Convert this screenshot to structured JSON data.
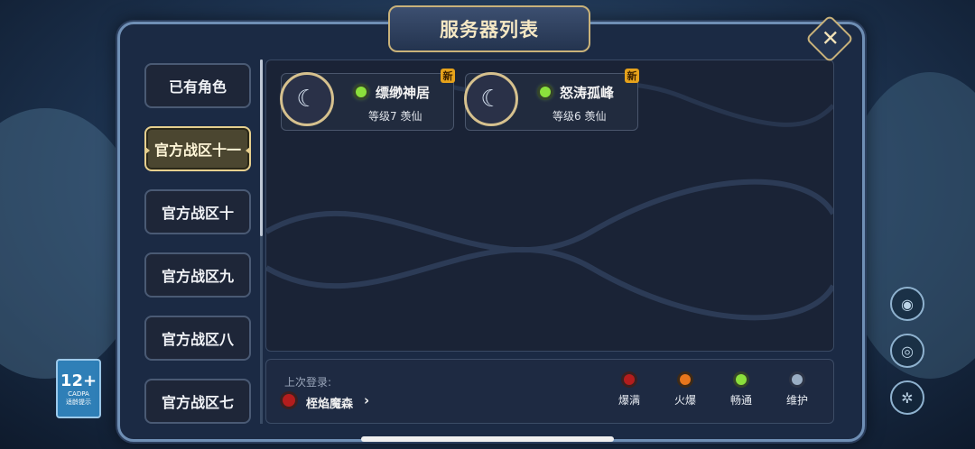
{
  "title": "服务器列表",
  "close_icon": "close-icon",
  "age_rating": {
    "number": "12+",
    "sub": "CADPA",
    "sub2": "适龄提示"
  },
  "tabs": [
    {
      "label": "已有角色",
      "active": false
    },
    {
      "label": "官方战区十一",
      "active": true
    },
    {
      "label": "官方战区十",
      "active": false
    },
    {
      "label": "官方战区九",
      "active": false
    },
    {
      "label": "官方战区八",
      "active": false
    },
    {
      "label": "官方战区七",
      "active": false
    }
  ],
  "servers": [
    {
      "name": "缥缈神居",
      "level": "等级7 羡仙",
      "badge": "新",
      "status": "畅通",
      "status_color": "#8be03c",
      "icon": "moon-portrait-icon"
    },
    {
      "name": "怒涛孤峰",
      "level": "等级6 羡仙",
      "badge": "新",
      "status": "畅通",
      "status_color": "#8be03c",
      "icon": "moon-portrait-icon"
    }
  ],
  "last_login": {
    "label": "上次登录:",
    "name": "桎焰魔森",
    "status_color": "#b31d1d"
  },
  "legend": [
    {
      "label": "爆满",
      "color": "#b31d1d"
    },
    {
      "label": "火爆",
      "color": "#e8761c"
    },
    {
      "label": "畅通",
      "color": "#8be03c"
    },
    {
      "label": "维护",
      "color": "#9aaec4"
    }
  ]
}
